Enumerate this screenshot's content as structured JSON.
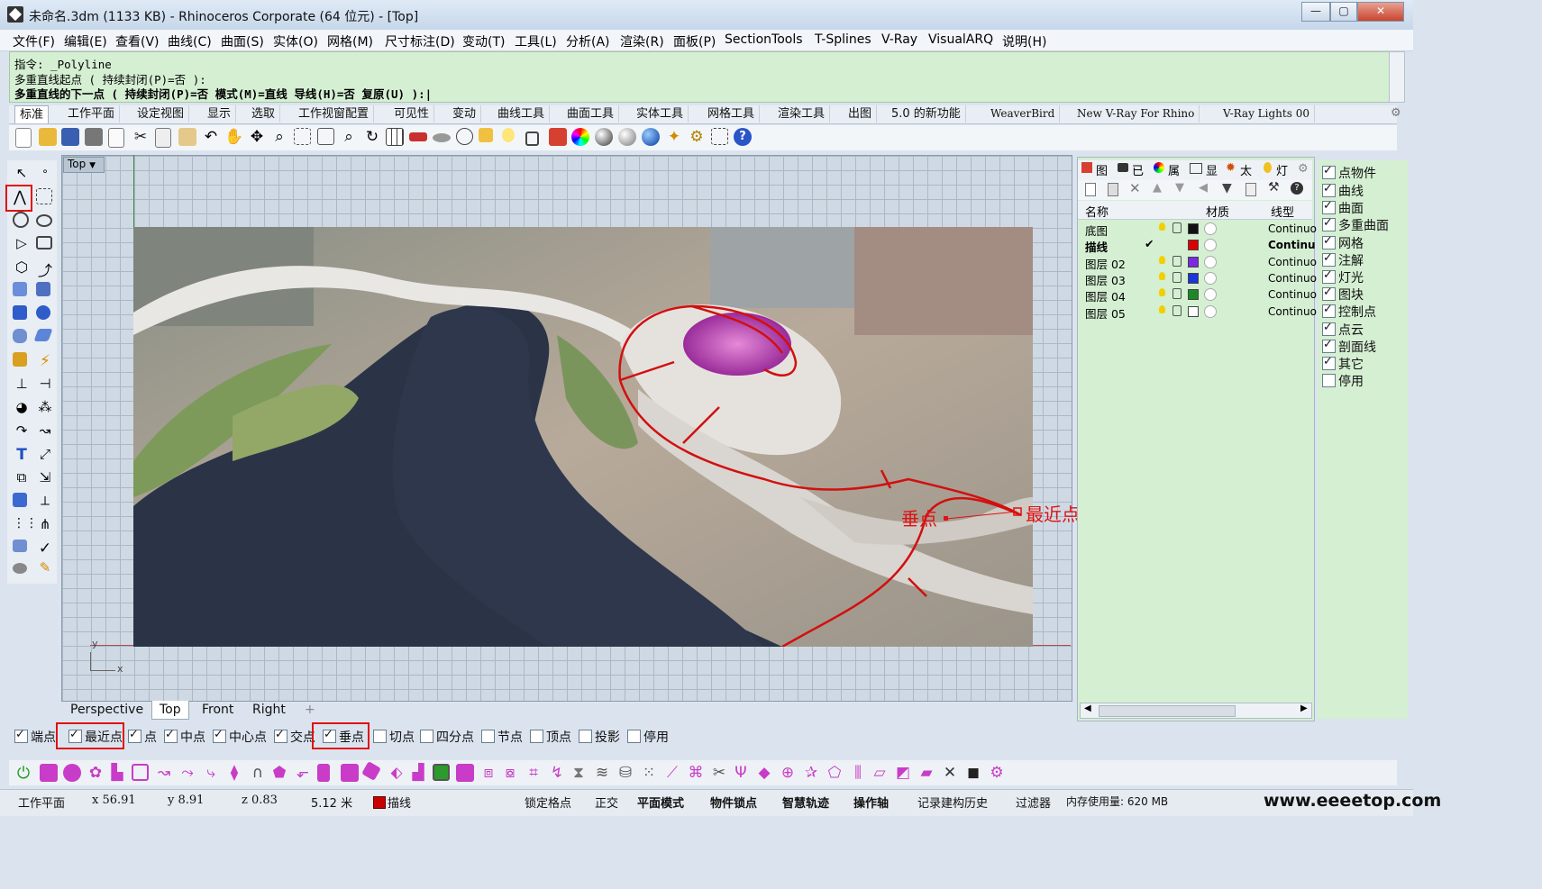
{
  "window": {
    "title": "未命名.3dm (1133 KB) - Rhinoceros Corporate (64 位元) - [Top]",
    "controls": {
      "minimize": "—",
      "maximize": "▢",
      "close": "✕"
    }
  },
  "menu": [
    "文件(F)",
    "编辑(E)",
    "查看(V)",
    "曲线(C)",
    "曲面(S)",
    "实体(O)",
    "网格(M)",
    "尺寸标注(D)",
    "变动(T)",
    "工具(L)",
    "分析(A)",
    "渲染(R)",
    "面板(P)",
    "SectionTools",
    "T-Splines",
    "V-Ray",
    "VisualARQ",
    "说明(H)"
  ],
  "command": {
    "line1": "指令: _Polyline",
    "line2": "多重直线起点 ( 持续封闭(P)=否 ):",
    "line3": "多重直线的下一点 ( 持续封闭(P)=否  模式(M)=直线  导线(H)=否  复原(U) ):|"
  },
  "toolbar_tabs": [
    "标准",
    "工作平面",
    "设定视图",
    "显示",
    "选取",
    "工作视窗配置",
    "可见性",
    "变动",
    "曲线工具",
    "曲面工具",
    "实体工具",
    "网格工具",
    "渲染工具",
    "出图",
    "5.0 的新功能",
    "WeaverBird",
    "New V-Ray For Rhino",
    "V-Ray Lights 00"
  ],
  "viewport": {
    "label": "Top",
    "axis_x": "x",
    "axis_y": "y",
    "annotation_perpendicular": "垂点",
    "annotation_nearest": "最近点"
  },
  "viewport_tabs": [
    "Perspective",
    "Top",
    "Front",
    "Right",
    "+"
  ],
  "osnap": [
    {
      "label": "端点",
      "checked": true
    },
    {
      "label": "最近点",
      "checked": true
    },
    {
      "label": "点",
      "checked": true
    },
    {
      "label": "中点",
      "checked": true
    },
    {
      "label": "中心点",
      "checked": true
    },
    {
      "label": "交点",
      "checked": true
    },
    {
      "label": "垂点",
      "checked": true
    },
    {
      "label": "切点",
      "checked": false
    },
    {
      "label": "四分点",
      "checked": false
    },
    {
      "label": "节点",
      "checked": false
    },
    {
      "label": "顶点",
      "checked": false
    },
    {
      "label": "投影",
      "checked": false
    },
    {
      "label": "停用",
      "checked": false
    }
  ],
  "status": {
    "cplane": "工作平面",
    "x": "x 56.91",
    "y": "y 8.91",
    "z": "z 0.83",
    "unit": "5.12 米",
    "layer": "描线",
    "grid_snap": "锁定格点",
    "ortho": "正交",
    "planar": "平面模式",
    "osnap": "物件锁点",
    "smarttrack": "智慧轨迹",
    "gumball": "操作轴",
    "history": "记录建构历史",
    "filter": "过滤器",
    "memory": "内存使用量: 620 MB",
    "watermark": "www.eeeetop.com"
  },
  "layer_panel": {
    "tabs": [
      "图",
      "已",
      "属",
      "显",
      "太",
      "灯"
    ],
    "headers": {
      "name": "名称",
      "material": "材质",
      "linetype": "线型"
    },
    "layers": [
      {
        "name": "底图",
        "color": "#111111",
        "linetype": "Continuo",
        "current": false
      },
      {
        "name": "描线",
        "color": "#dd0000",
        "linetype": "Continu",
        "current": true
      },
      {
        "name": "图层 02",
        "color": "#7a2be0",
        "linetype": "Continuo",
        "current": false
      },
      {
        "name": "图层 03",
        "color": "#1a35d8",
        "linetype": "Continuo",
        "current": false
      },
      {
        "name": "图层 04",
        "color": "#1c8a22",
        "linetype": "Continuo",
        "current": false
      },
      {
        "name": "图层 05",
        "color": "#ffffff",
        "linetype": "Continuo",
        "current": false
      }
    ],
    "current_mark": "✔"
  },
  "display_filter": [
    {
      "label": "点物件",
      "checked": true
    },
    {
      "label": "曲线",
      "checked": true
    },
    {
      "label": "曲面",
      "checked": true
    },
    {
      "label": "多重曲面",
      "checked": true
    },
    {
      "label": "网格",
      "checked": true
    },
    {
      "label": "注解",
      "checked": true
    },
    {
      "label": "灯光",
      "checked": true
    },
    {
      "label": "图块",
      "checked": true
    },
    {
      "label": "控制点",
      "checked": true
    },
    {
      "label": "点云",
      "checked": true
    },
    {
      "label": "剖面线",
      "checked": true
    },
    {
      "label": "其它",
      "checked": true
    },
    {
      "label": "停用",
      "checked": false
    }
  ]
}
